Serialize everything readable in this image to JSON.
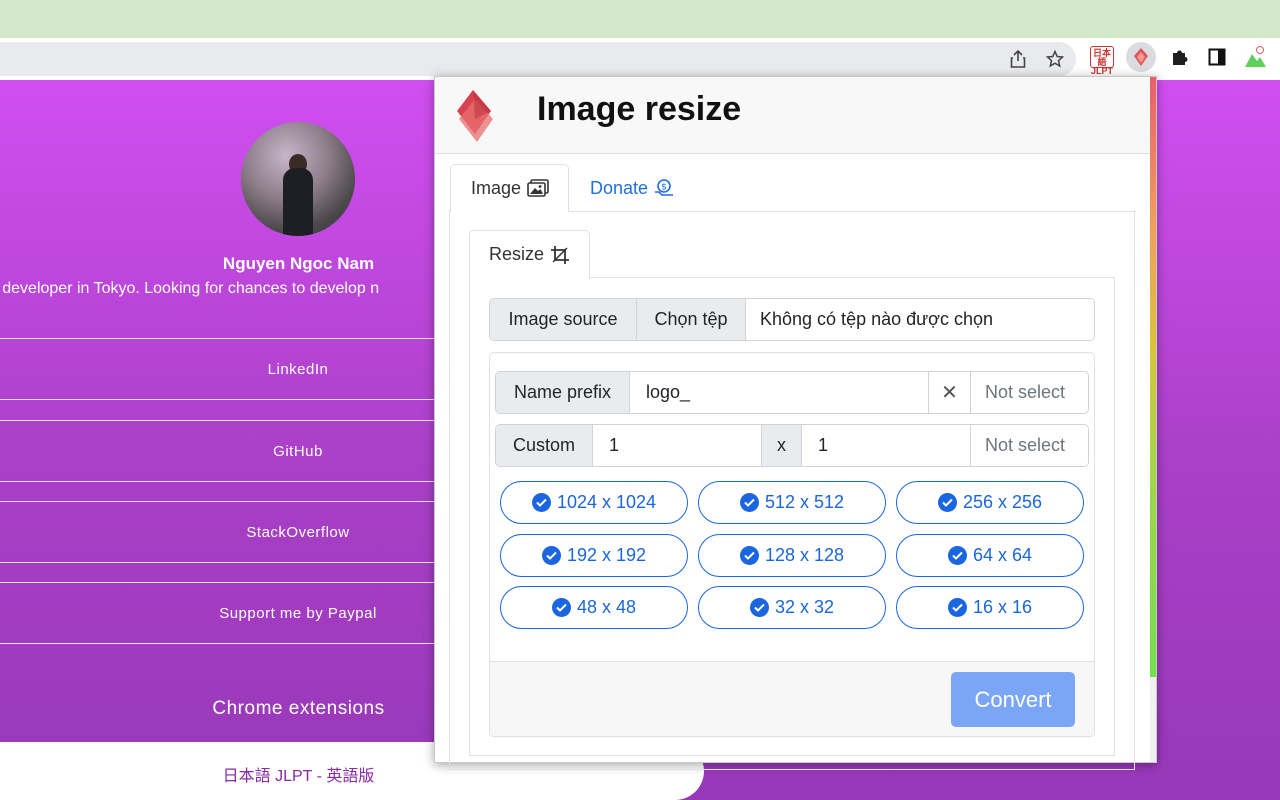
{
  "profile": {
    "name": "Nguyen Ngoc Nam",
    "bio": "eb developer in Tokyo. Looking for chances to develop n",
    "links": [
      "LinkedIn",
      "GitHub",
      "StackOverflow",
      "Support me by Paypal"
    ],
    "section_heading": "Chrome extensions",
    "footer_link": "日本語 JLPT - 英語版"
  },
  "toolbar": {
    "icons": [
      "share-icon",
      "star-icon",
      "jlpt-extension-icon",
      "image-resize-extension-icon",
      "puzzle-icon",
      "sidepanel-icon",
      "profile-icon"
    ],
    "jlpt_badge": "日本語 JLPT"
  },
  "popup": {
    "title": "Image resize",
    "tabs": [
      {
        "label": "Image",
        "icon": "images-icon"
      },
      {
        "label": "Donate",
        "icon": "donate-icon"
      }
    ],
    "subtab": {
      "label": "Resize",
      "icon": "crop-icon"
    },
    "file": {
      "label": "Image source",
      "button": "Chọn tệp",
      "status": "Không có tệp nào được chọn"
    },
    "name_prefix": {
      "label": "Name prefix",
      "value": "logo_",
      "clear": "✕",
      "select": "Not select"
    },
    "custom": {
      "label": "Custom",
      "width": "1",
      "separator": "x",
      "height": "1",
      "select": "Not select"
    },
    "sizes": [
      "1024 x 1024",
      "512 x 512",
      "256 x 256",
      "192 x 192",
      "128 x 128",
      "64 x 64",
      "48 x 48",
      "32 x 32",
      "16 x 16"
    ],
    "convert": "Convert"
  },
  "colors": {
    "accent": "#1a66e0",
    "convert_disabled": "#7ba6f5",
    "page_gradient_top": "#d14ef0",
    "page_gradient_bottom": "#9738b8"
  }
}
